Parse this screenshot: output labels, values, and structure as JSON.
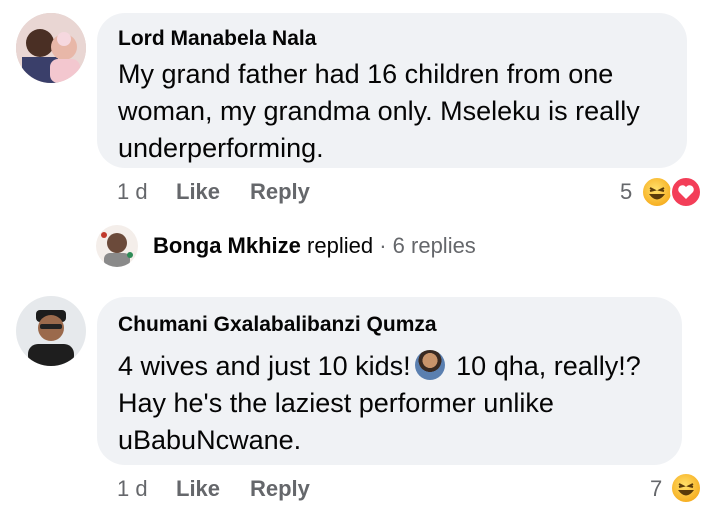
{
  "comments": [
    {
      "author": "Lord Manabela Nala",
      "text": "My grand father had 16 children from one woman, my grandma only. Mseleku is really underperforming.",
      "time": "1 d",
      "like_label": "Like",
      "reply_label": "Reply",
      "reaction_count": "5",
      "reactions": [
        "haha-icon",
        "love-icon"
      ]
    },
    {
      "author": "Chumani Gxalabalibanzi Qumza",
      "text_before_emoji": "4 wives and just 10 kids!",
      "inline_emoji": "person-gesturing-ok-icon",
      "text_after_emoji": " 10 qha, really!? Hay he's the laziest performer unlike uBabuNcwane.",
      "time": "1 d",
      "like_label": "Like",
      "reply_label": "Reply",
      "reaction_count": "7",
      "reactions": [
        "haha-icon"
      ]
    }
  ],
  "reply_summary": {
    "name": "Bonga Mkhize",
    "action": "replied",
    "separator": "·",
    "count": "6 replies"
  },
  "colors": {
    "bubble": "#f0f2f5",
    "meta": "#65676b",
    "text": "#050505",
    "love": "#f33e58",
    "haha": "#f7b125"
  }
}
